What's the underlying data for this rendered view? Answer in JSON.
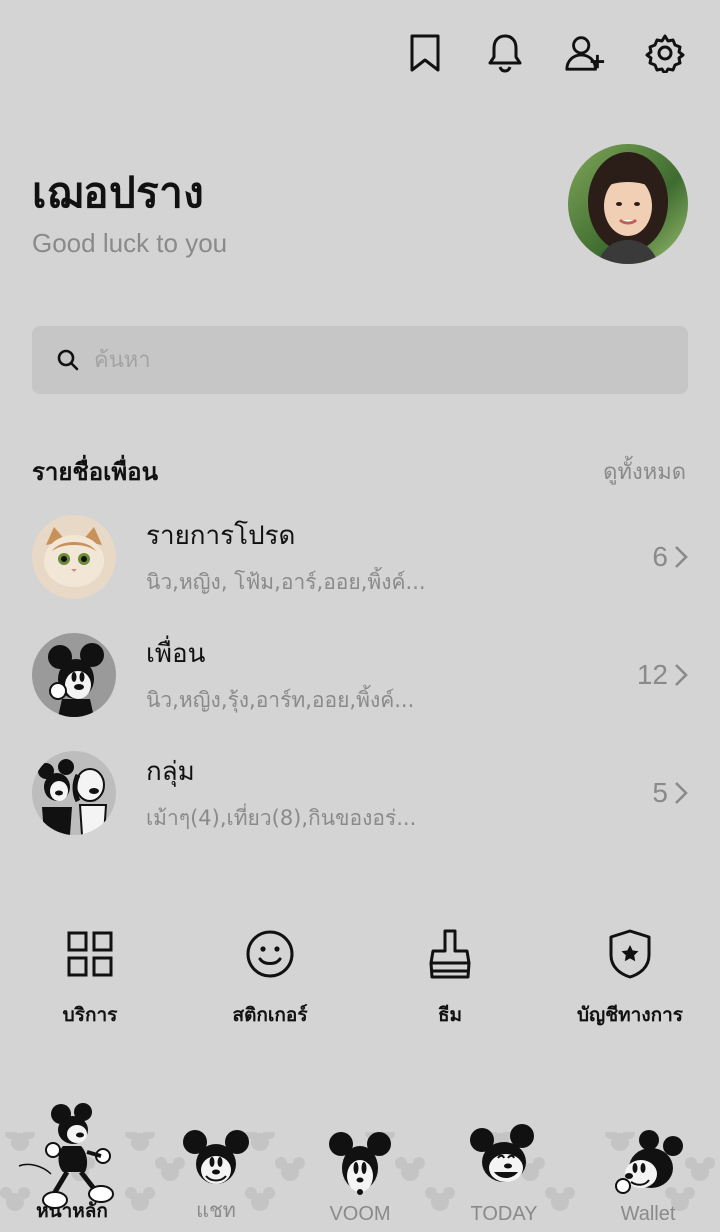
{
  "profile": {
    "name": "เฌอปราง",
    "status": "Good luck to you"
  },
  "header": {
    "icons": [
      "bookmark-icon",
      "bell-icon",
      "add-friend-icon",
      "gear-icon"
    ]
  },
  "search": {
    "placeholder": "ค้นหา",
    "value": ""
  },
  "friends_section": {
    "title": "รายชื่อเพื่อน",
    "see_all": "ดูทั้งหมด",
    "rows": [
      {
        "title": "รายการโปรด",
        "subtitle": "นิว,หญิง, โฟ้ม,อาร์,ออย,พิ้งค์...",
        "count": "6"
      },
      {
        "title": "เพื่อน",
        "subtitle": "นิว,หญิง,รุ้ง,อาร์ท,ออย,พิ้งค์...",
        "count": "12"
      },
      {
        "title": "กลุ่ม",
        "subtitle": "เม้าๆ(4),เที่ยว(8),กินของอร่...",
        "count": "5"
      }
    ]
  },
  "services": [
    {
      "label": "บริการ",
      "icon": "grid-icon"
    },
    {
      "label": "สติกเกอร์",
      "icon": "smiley-icon"
    },
    {
      "label": "ธีม",
      "icon": "brush-icon"
    },
    {
      "label": "บัญชีทางการ",
      "icon": "shield-star-icon"
    }
  ],
  "bottom_nav": [
    {
      "label": "หน้าหลัก",
      "active": true
    },
    {
      "label": "แชท",
      "active": false
    },
    {
      "label": "VOOM",
      "active": false
    },
    {
      "label": "TODAY",
      "active": false
    },
    {
      "label": "Wallet",
      "active": false
    }
  ],
  "colors": {
    "background": "#d4d4d4",
    "search_bg": "#c6c6c6",
    "muted_text": "#8a8a8a",
    "text": "#111111"
  }
}
